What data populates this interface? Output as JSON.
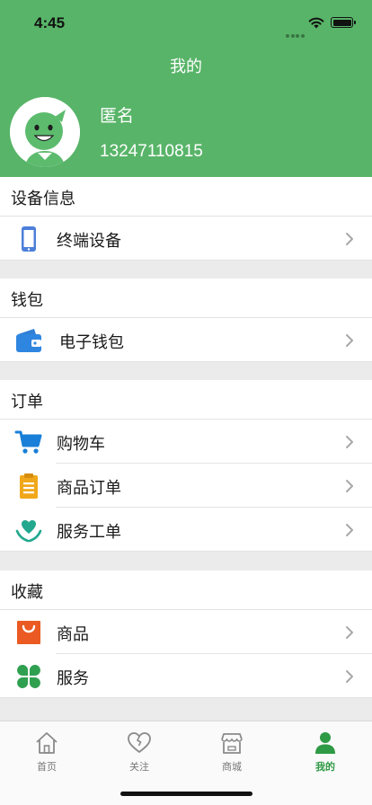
{
  "status": {
    "time": "4:45"
  },
  "header": {
    "title": "我的",
    "user_name": "匿名",
    "phone": "13247110815"
  },
  "sections": {
    "device": {
      "title": "设备信息",
      "items": [
        {
          "label": "终端设备",
          "icon": "phone-icon"
        }
      ]
    },
    "wallet": {
      "title": "钱包",
      "items": [
        {
          "label": "电子钱包",
          "icon": "wallet-icon"
        }
      ]
    },
    "orders": {
      "title": "订单",
      "items": [
        {
          "label": "购物车",
          "icon": "cart-icon"
        },
        {
          "label": "商品订单",
          "icon": "clipboard-icon"
        },
        {
          "label": "服务工单",
          "icon": "heart-hands-icon"
        }
      ]
    },
    "favorites": {
      "title": "收藏",
      "items": [
        {
          "label": "商品",
          "icon": "shopping-bag-icon"
        },
        {
          "label": "服务",
          "icon": "clover-icon"
        }
      ]
    }
  },
  "tabbar": {
    "items": [
      {
        "label": "首页",
        "icon": "home-icon"
      },
      {
        "label": "关注",
        "icon": "heart-icon"
      },
      {
        "label": "商城",
        "icon": "store-icon"
      },
      {
        "label": "我的",
        "icon": "person-icon",
        "active": true
      }
    ]
  },
  "colors": {
    "header": "#58b468",
    "active_tab": "#2e9a45",
    "separator": "#ebebeb"
  }
}
